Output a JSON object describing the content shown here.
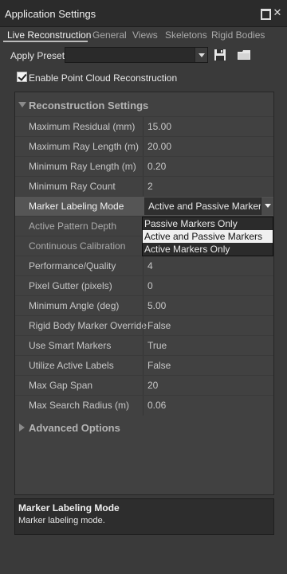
{
  "window": {
    "title": "Application Settings"
  },
  "tabs": [
    {
      "label": "Live Reconstruction"
    },
    {
      "label": "General"
    },
    {
      "label": "Views"
    },
    {
      "label": "Skeletons"
    },
    {
      "label": "Rigid Bodies"
    }
  ],
  "preset": {
    "label": "Apply Preset",
    "value": ""
  },
  "enable_point_cloud": {
    "label": "Enable Point Cloud Reconstruction",
    "checked": true
  },
  "sections": {
    "reconstruction": {
      "label": "Reconstruction Settings",
      "expanded": true
    },
    "advanced": {
      "label": "Advanced Options",
      "expanded": false
    }
  },
  "settings": [
    {
      "key": "Maximum Residual (mm)",
      "value": "15.00"
    },
    {
      "key": "Maximum Ray Length (m)",
      "value": "20.00"
    },
    {
      "key": "Minimum Ray Length (m)",
      "value": "0.20"
    },
    {
      "key": "Minimum Ray Count",
      "value": "2"
    },
    {
      "key": "Marker Labeling Mode",
      "value": "Active and Passive Markers"
    },
    {
      "key": "Active Pattern Depth",
      "value": ""
    },
    {
      "key": "Continuous Calibration",
      "value": ""
    },
    {
      "key": "Performance/Quality",
      "value": "4"
    },
    {
      "key": "Pixel Gutter (pixels)",
      "value": "0"
    },
    {
      "key": "Minimum Angle (deg)",
      "value": "5.00"
    },
    {
      "key": "Rigid Body Marker Override",
      "value": "False"
    },
    {
      "key": "Use Smart Markers",
      "value": "True"
    },
    {
      "key": "Utilize Active Labels",
      "value": "False"
    },
    {
      "key": "Max Gap Span",
      "value": "20"
    },
    {
      "key": "Max Search Radius (m)",
      "value": "0.06"
    }
  ],
  "dropdown": {
    "options": [
      "Passive Markers Only",
      "Active and Passive Markers",
      "Active Markers Only"
    ],
    "highlighted": "Active and Passive Markers"
  },
  "help": {
    "title": "Marker Labeling Mode",
    "text": "Marker labeling mode."
  }
}
